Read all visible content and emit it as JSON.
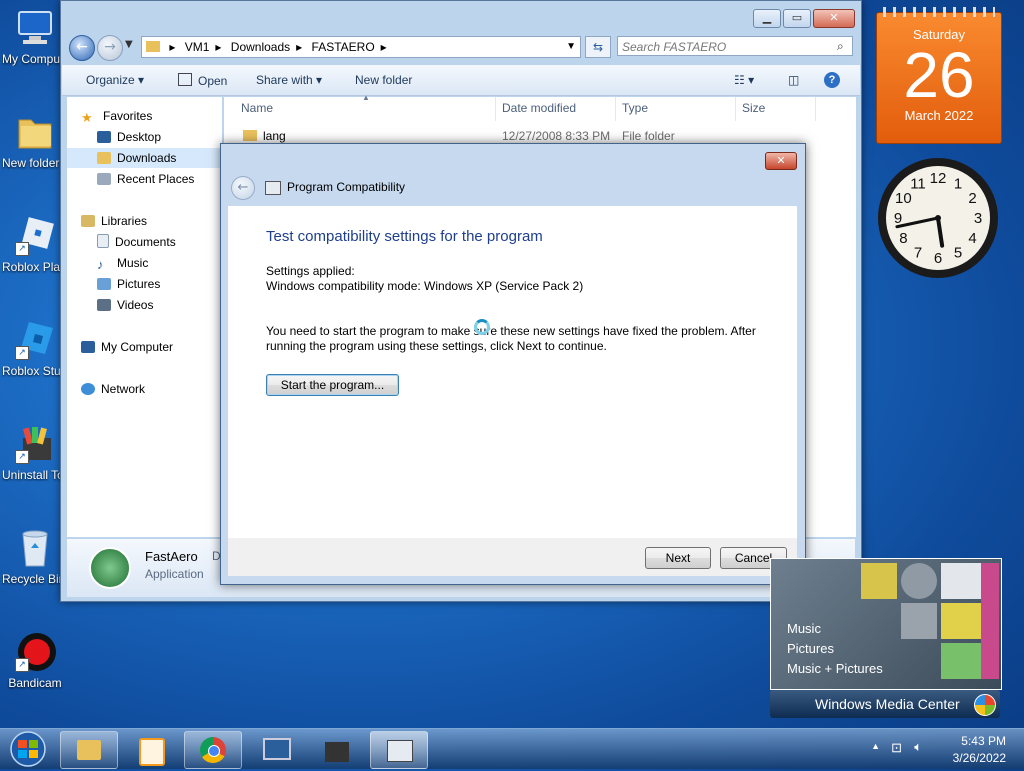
{
  "desktop": {
    "icons": [
      {
        "label": "My Computer",
        "icon": "computer-icon"
      },
      {
        "label": "New folder",
        "icon": "folder-icon"
      },
      {
        "label": "Roblox Player",
        "icon": "roblox-icon"
      },
      {
        "label": "Roblox Studio",
        "icon": "roblox-studio-icon"
      },
      {
        "label": "Uninstall Tool",
        "icon": "uninstall-icon"
      },
      {
        "label": "Recycle Bin",
        "icon": "recycle-bin-icon"
      },
      {
        "label": "Bandicam",
        "icon": "bandicam-icon"
      }
    ]
  },
  "explorer": {
    "breadcrumb": [
      "VM1",
      "Downloads",
      "FASTAERO"
    ],
    "search_placeholder": "Search FASTAERO",
    "toolbar": {
      "organize": "Organize",
      "open": "Open",
      "share_with": "Share with",
      "new_folder": "New folder"
    },
    "nav": {
      "favorites": "Favorites",
      "desktop": "Desktop",
      "downloads": "Downloads",
      "recent_places": "Recent Places",
      "libraries": "Libraries",
      "documents": "Documents",
      "music": "Music",
      "pictures": "Pictures",
      "videos": "Videos",
      "my_computer": "My Computer",
      "network": "Network"
    },
    "columns": {
      "name": "Name",
      "date_modified": "Date modified",
      "type": "Type",
      "size": "Size"
    },
    "files": [
      {
        "name": "lang",
        "date": "12/27/2008 8:33 PM",
        "type": "File folder",
        "size": ""
      }
    ],
    "details": {
      "name": "FastAero",
      "type": "Application",
      "extra": "D"
    }
  },
  "dialog": {
    "title": "Program Compatibility",
    "heading": "Test compatibility settings for the program",
    "settings_label": "Settings applied:",
    "settings_value": "Windows compatibility mode: Windows XP (Service Pack 2)",
    "instruction_1": "You need to start the program to make sure these new settings have fixed the problem. After",
    "instruction_2": "running the program using these settings, click Next to continue.",
    "start_button": "Start the program...",
    "next_button": "Next",
    "cancel_button": "Cancel"
  },
  "calendar": {
    "weekday": "Saturday",
    "day": "26",
    "month_year": "March 2022"
  },
  "clock": {
    "numbers": [
      "12",
      "1",
      "2",
      "3",
      "4",
      "5",
      "6",
      "7",
      "8",
      "9",
      "10",
      "11"
    ],
    "hour": 5,
    "minute": 43
  },
  "media_center": {
    "items": [
      "Music",
      "Pictures",
      "Music + Pictures"
    ],
    "title": "Windows Media Center"
  },
  "taskbar": {
    "apps": [
      "explorer",
      "media-player",
      "chrome",
      "network-computer",
      "uninstall-tool",
      "program-compatibility"
    ],
    "time": "5:43 PM",
    "date": "3/26/2022"
  }
}
